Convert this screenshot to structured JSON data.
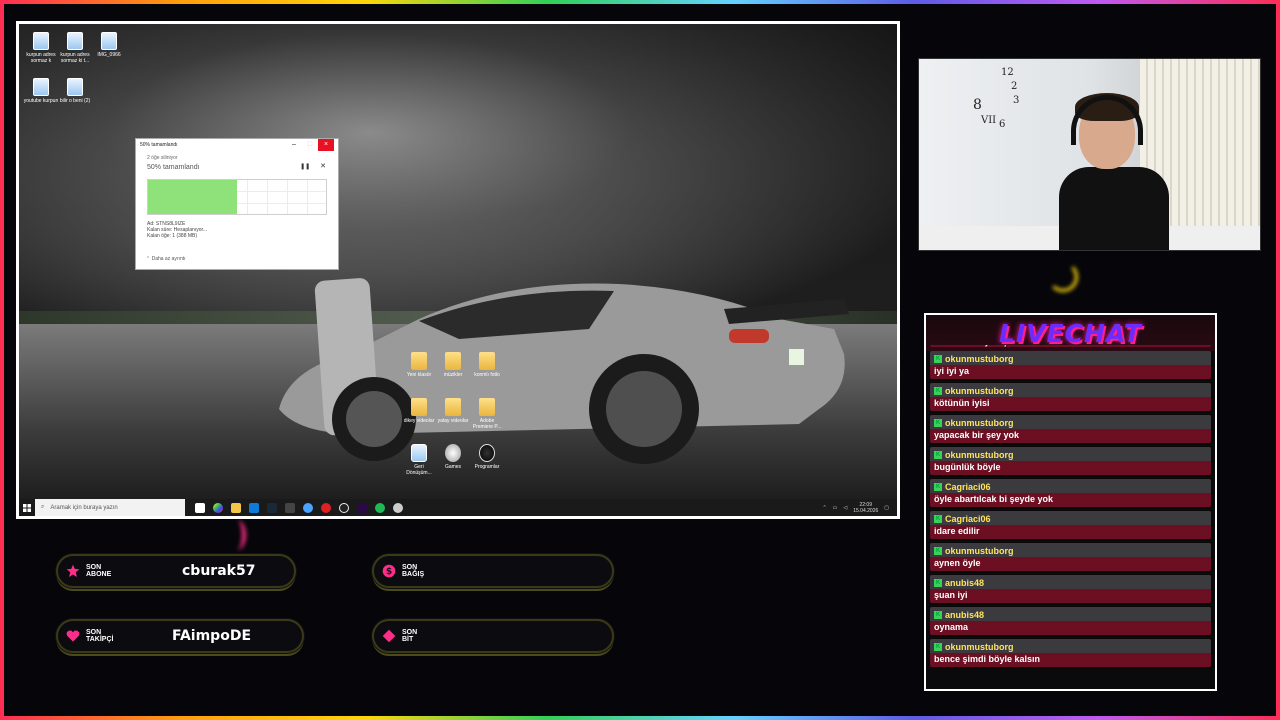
{
  "desktop": {
    "icons": [
      {
        "label": "kurpun adres sormaz k"
      },
      {
        "label": "kurpun adres sormaz ki t..."
      },
      {
        "label": "IMG_0966"
      },
      {
        "label": "youtube kurpun"
      },
      {
        "label": "bilir o beni (2)"
      }
    ],
    "center_icons": [
      {
        "label": "Yeni klasör"
      },
      {
        "label": "müzikler"
      },
      {
        "label": "konmlı fotlo"
      },
      {
        "label": "dikey videolar"
      },
      {
        "label": "yatay videolar"
      },
      {
        "label": "Adobe Premiere P..."
      },
      {
        "label": "Geri Dönüşüm..."
      },
      {
        "label": "Games"
      },
      {
        "label": "Programlar"
      }
    ]
  },
  "copy_dialog": {
    "title": "50% tamamlandı",
    "subtitle": "2 öğe siliniyor",
    "percent_label": "50% tamamlandı",
    "progress": 0.5,
    "name_line": "Ad: STNS8L9IZE",
    "time_line": "Kalan süre: Hesaplanıyor...",
    "items_line": "Kalan öğe: 1 (388 MB)",
    "less_details": "Daha az ayrıntı",
    "pause_icon": "pause-icon",
    "close_icon": "close-icon"
  },
  "taskbar": {
    "search_placeholder": "Aramak için buraya yazın",
    "time": "22:09",
    "date": "15.04.2026"
  },
  "chat": {
    "title": "LIVECHAT",
    "cut_message": "ama ts senin yine çöktü",
    "messages": [
      {
        "user": "okunmustuborg",
        "text": "iyi iyi ya"
      },
      {
        "user": "okunmustuborg",
        "text": "kötünün iyisi"
      },
      {
        "user": "okunmustuborg",
        "text": "yapacak bir şey yok"
      },
      {
        "user": "okunmustuborg",
        "text": "bugünlük böyle"
      },
      {
        "user": "Cagriaci06",
        "text": "öyle abartılcak bi şeyde yok"
      },
      {
        "user": "Cagriaci06",
        "text": "idare edilir"
      },
      {
        "user": "okunmustuborg",
        "text": "aynen öyle"
      },
      {
        "user": "anubis48",
        "text": "şuan iyi"
      },
      {
        "user": "anubis48",
        "text": "oynama"
      },
      {
        "user": "okunmustuborg",
        "text": "bence şimdi böyle kalsın"
      }
    ]
  },
  "alerts": {
    "sub": {
      "label1": "SON",
      "label2": "ABONE",
      "value": "cburak57"
    },
    "donation": {
      "label1": "SON",
      "label2": "BAĞIŞ",
      "value": ""
    },
    "follower": {
      "label1": "SON",
      "label2": "TAKİPÇİ",
      "value": "FAimpoDE"
    },
    "bits": {
      "label1": "SON",
      "label2": "BİT",
      "value": ""
    }
  },
  "colors": {
    "chat_title": "#6a2cff",
    "chat_user": "#ffe45c",
    "chat_row": "#6d0f22",
    "progress_fill": "#8fe27a"
  }
}
